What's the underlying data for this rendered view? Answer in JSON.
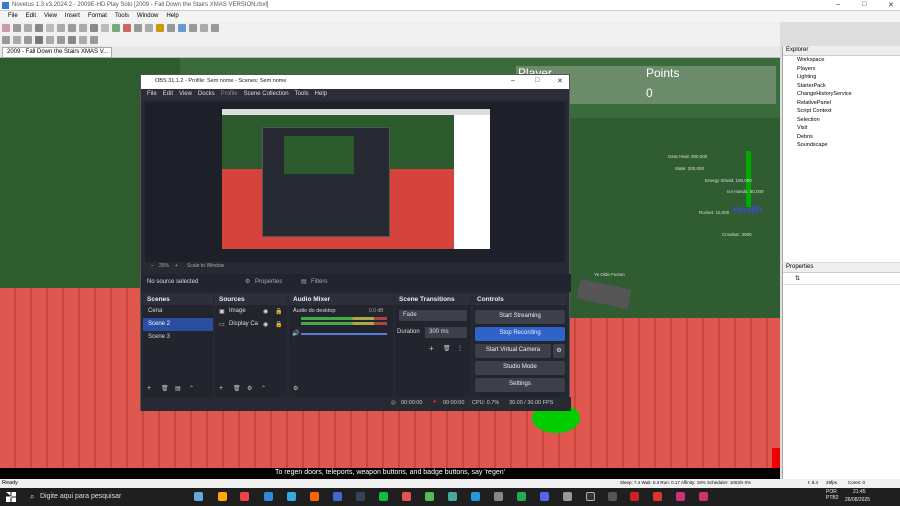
{
  "app": {
    "title": "Novetus 1.3 v3.2024.2 - 2009E-HD Play Solo [2009 - Fall Down the Stairs XMAS VERSION.rbxl]",
    "doc_tab": "2009 - Fall Down the Stairs XMAS V..."
  },
  "menu": [
    "File",
    "Edit",
    "View",
    "Insert",
    "Format",
    "Tools",
    "Window",
    "Help"
  ],
  "game": {
    "hud_label_player": "Player",
    "hud_label_points": "Points",
    "points_value": "0",
    "health_label": "Health",
    "chat": "To regen doors, teleports, weapon buttons, and badge buttons, say 'regen'",
    "labels": [
      "Gear Heal: 300,000",
      "Slate: 200,000",
      "Energy Shield: 100,000",
      "Ice Hands: 60,000",
      "Rocket: 15,000",
      "Crowbar: 3000",
      "Ye Olde Fusion"
    ]
  },
  "explorer": {
    "title": "Explorer",
    "items": [
      "Workspace",
      "Players",
      "Lighting",
      "StarterPack",
      "ChangeHistoryService",
      "RelativePanel",
      "Script Context",
      "Selection",
      "Visit",
      "Debris",
      "Soundscape"
    ]
  },
  "properties": {
    "title": "Properties"
  },
  "status": {
    "left": "Ready",
    "right": "Sleep: 7.4 Wait: 0.3 Run: 0.17 Affinity: 19% Scheduler: 1003/s 0%",
    "fps": "29fps",
    "cores": "Cores: 0",
    "extra": "t: 8.4"
  },
  "taskbar": {
    "search": "Digite aqui para pesquisar",
    "lang": "POR PTB2",
    "time": "21:45",
    "date": "26/08/2025"
  },
  "obs": {
    "title": "OBS 31.1.2 - Profile: Sem nome - Scenes: Sem nome",
    "menu": [
      "File",
      "Edit",
      "View",
      "Docks",
      "Profile",
      "Scene Collection",
      "Tools",
      "Help"
    ],
    "zoom": "25%",
    "scale": "Scale to Window",
    "no_source": "No source selected",
    "properties_btn": "Properties",
    "filters_btn": "Filters",
    "scenes_title": "Scenes",
    "scenes": [
      "Cena",
      "Scene 2",
      "Scene 3"
    ],
    "sources_title": "Sources",
    "sources": [
      "Image",
      "Display Ca"
    ],
    "mixer_title": "Audio Mixer",
    "mixer_track": "Áudio do desktop",
    "mixer_db": "0.0 dB",
    "transitions_title": "Scene Transitions",
    "transition": "Fade",
    "duration_label": "Duration",
    "duration": "300 ms",
    "controls_title": "Controls",
    "controls": [
      "Start Streaming",
      "Stop Recording",
      "Start Virtual Camera",
      "Studio Mode",
      "Settings"
    ],
    "stat_stream": "00:00:00",
    "stat_rec": "00:00:00",
    "stat_cpu": "CPU: 0.7%",
    "stat_fps": "30.00 / 30.00 FPS"
  }
}
